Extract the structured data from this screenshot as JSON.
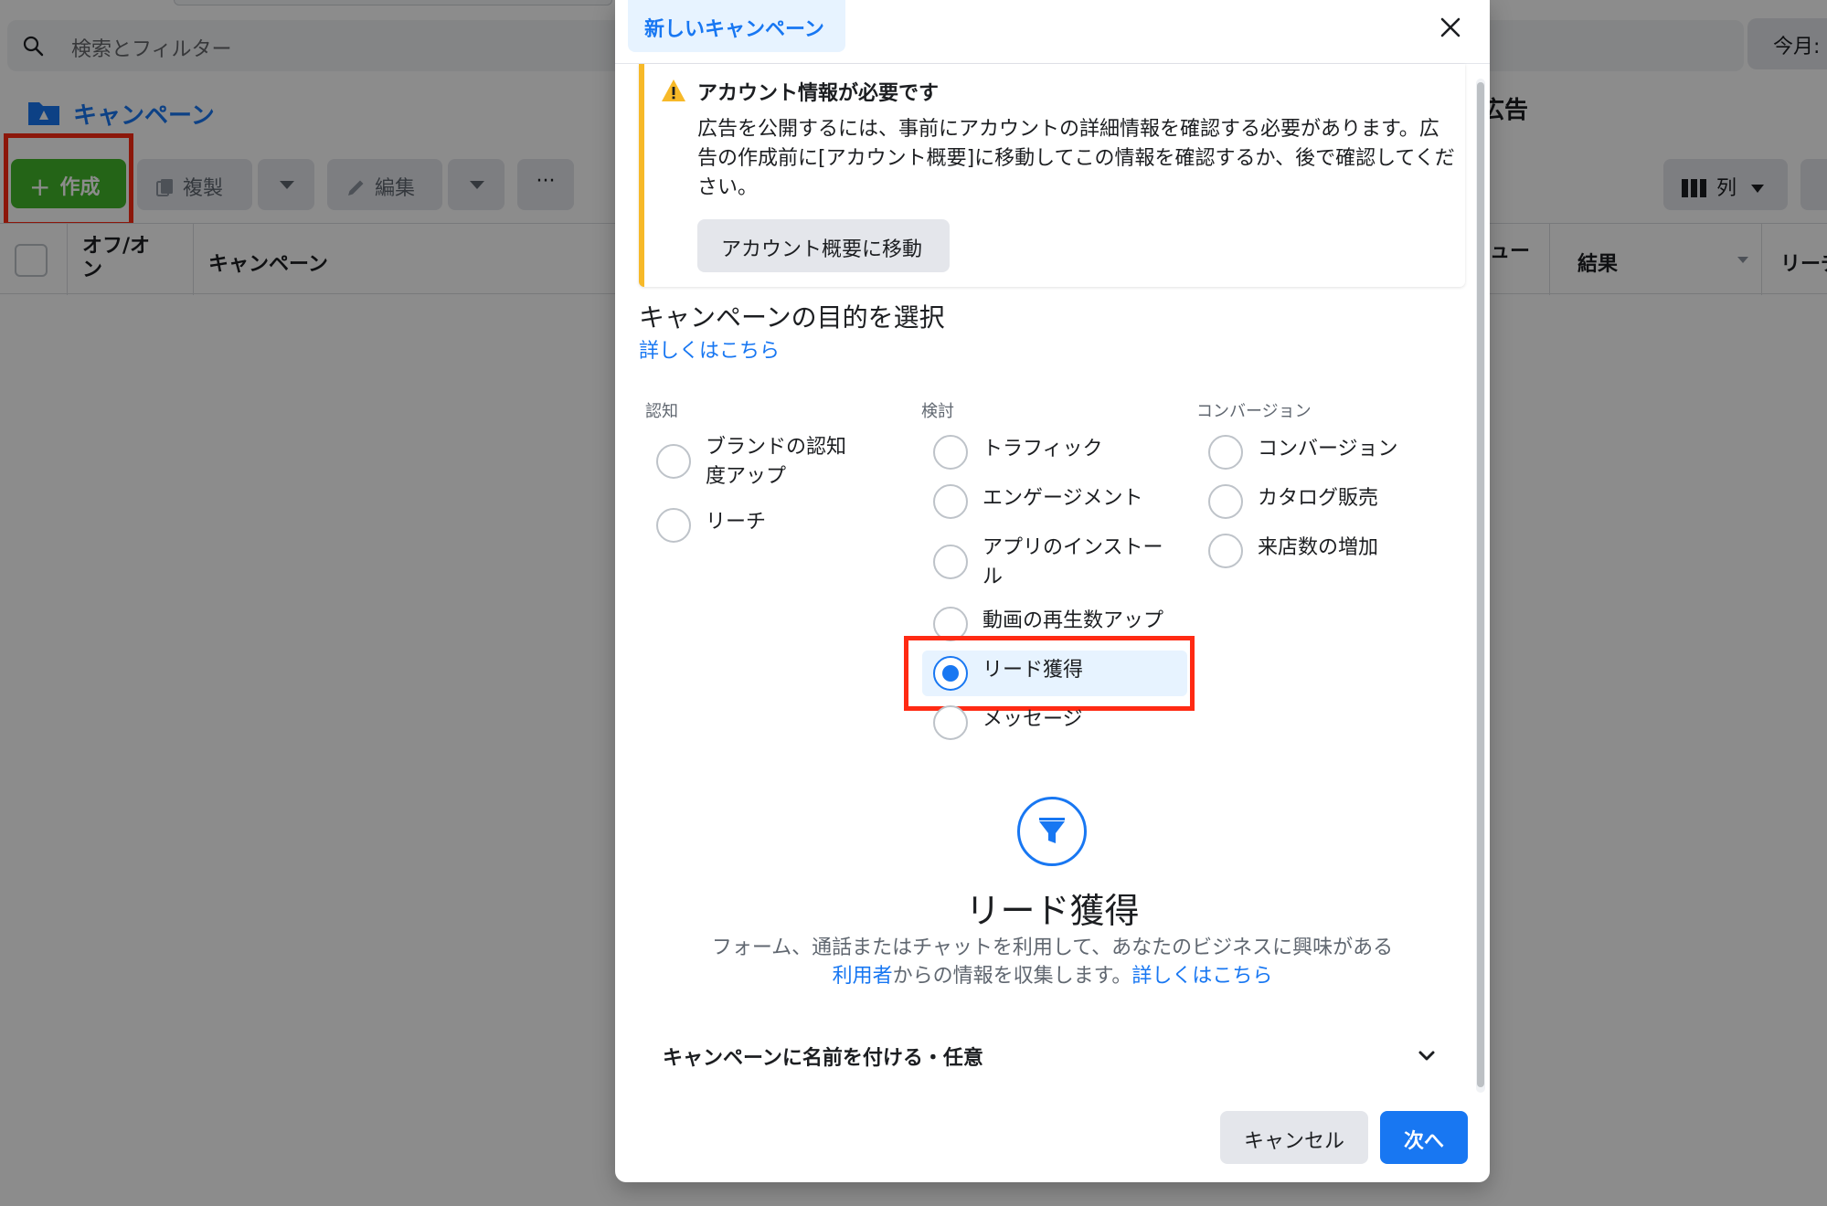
{
  "background": {
    "search_placeholder": "検索とフィルター",
    "date_pill": "今月:",
    "campaign_tab": "キャンペーン",
    "ads_tab": "広告",
    "toolbar": {
      "create": "作成",
      "duplicate": "複製",
      "edit": "編集",
      "more": "···",
      "columns": "列"
    },
    "table_headers": {
      "onoff": "オフ/オン",
      "campaign": "キャンペーン",
      "review": "ュー",
      "results": "結果",
      "reach": "リーチ"
    }
  },
  "modal": {
    "tab": "新しいキャンペーン",
    "alert": {
      "title": "アカウント情報が必要です",
      "body": "広告を公開するには、事前にアカウントの詳細情報を確認する必要があります。広告の作成前に[アカウント概要]に移動してこの情報を確認するか、後で確認してください。",
      "button": "アカウント概要に移動"
    },
    "section_title": "キャンペーンの目的を選択",
    "learn_more": "詳しくはこちら",
    "columns": [
      {
        "heading": "認知",
        "options": [
          "ブランドの認知度アップ",
          "リーチ"
        ]
      },
      {
        "heading": "検討",
        "options": [
          "トラフィック",
          "エンゲージメント",
          "アプリのインストール",
          "動画の再生数アップ",
          "リード獲得",
          "メッセージ"
        ]
      },
      {
        "heading": "コンバージョン",
        "options": [
          "コンバージョン",
          "カタログ販売",
          "来店数の増加"
        ]
      }
    ],
    "selected_option": "リード獲得",
    "detail": {
      "title": "リード獲得",
      "desc_part1": "フォーム、通話またはチャットを利用して、あなたのビジネスに興味がある",
      "desc_link1": "利用者",
      "desc_part2": "からの情報を収集します。",
      "desc_link2": "詳しくはこちら"
    },
    "name_row": "キャンペーンに名前を付ける・任意",
    "cancel": "キャンセル",
    "next": "次へ"
  },
  "colors": {
    "accent": "#1877f2",
    "create_green": "#42b72a",
    "highlight_red": "#ff2a13",
    "warning": "#f7b928"
  }
}
